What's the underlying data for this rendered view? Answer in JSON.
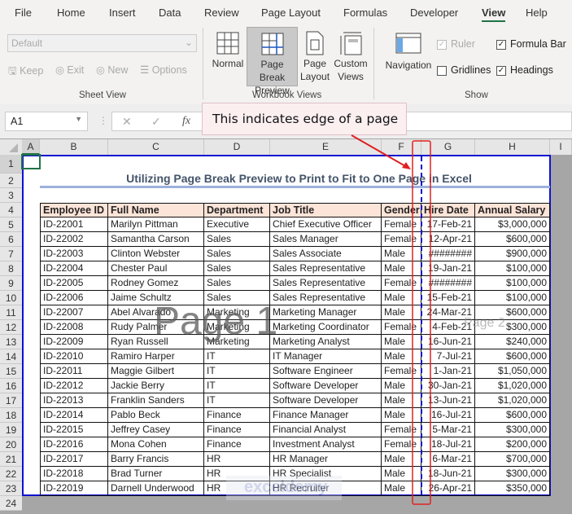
{
  "ribbon": {
    "tabs": [
      "File",
      "Home",
      "Insert",
      "Data",
      "Review",
      "Page Layout",
      "Formulas",
      "Developer",
      "View",
      "Help"
    ],
    "active_tab": "View",
    "sheet_view": {
      "dropdown": "Default",
      "keep": "Keep",
      "exit": "Exit",
      "new": "New",
      "options": "Options",
      "label": "Sheet View"
    },
    "workbook_views": {
      "normal": "Normal",
      "page_break_1": "Page Break",
      "page_break_2": "Preview",
      "page_layout_1": "Page",
      "page_layout_2": "Layout",
      "custom_1": "Custom",
      "custom_2": "Views",
      "label": "Workbook Views"
    },
    "show": {
      "navigation": "Navigation",
      "ruler": "Ruler",
      "ruler_checked": true,
      "formula_bar": "Formula Bar",
      "formula_bar_checked": true,
      "gridlines": "Gridlines",
      "gridlines_checked": false,
      "headings": "Headings",
      "headings_checked": true,
      "label": "Show"
    }
  },
  "formula_bar": {
    "name_box": "A1",
    "fx": "fx",
    "cancel": "✕",
    "enter": "✓",
    "formula": ""
  },
  "callout": "This indicates edge of a page",
  "columns": [
    "A",
    "B",
    "C",
    "D",
    "E",
    "F",
    "G",
    "H",
    "I"
  ],
  "rows": [
    "1",
    "2",
    "3",
    "4",
    "5",
    "6",
    "7",
    "8",
    "9",
    "10",
    "11",
    "12",
    "13",
    "14",
    "15",
    "16",
    "17",
    "18",
    "19",
    "20",
    "21",
    "22",
    "23",
    "24"
  ],
  "sheet": {
    "title": "Utilizing Page Break Preview to Print to Fit to One Page in Excel",
    "headers": [
      "Employee ID",
      "Full Name",
      "Department",
      "Job Title",
      "Gender",
      "Hire Date",
      "Annual Salary"
    ],
    "data": [
      [
        "ID-22001",
        "Marilyn Pittman",
        "Executive",
        "Chief Executive Officer",
        "Female",
        "17-Feb-21",
        "$3,000,000"
      ],
      [
        "ID-22002",
        "Samantha Carson",
        "Sales",
        "Sales Manager",
        "Female",
        "12-Apr-21",
        "$600,000"
      ],
      [
        "ID-22003",
        "Clinton Webster",
        "Sales",
        "Sales Associate",
        "Male",
        "########",
        "$900,000"
      ],
      [
        "ID-22004",
        "Chester Paul",
        "Sales",
        "Sales Representative",
        "Male",
        "19-Jan-21",
        "$100,000"
      ],
      [
        "ID-22005",
        "Rodney Gomez",
        "Sales",
        "Sales Representative",
        "Female",
        "########",
        "$100,000"
      ],
      [
        "ID-22006",
        "Jaime Schultz",
        "Sales",
        "Sales Representative",
        "Male",
        "15-Feb-21",
        "$100,000"
      ],
      [
        "ID-22007",
        "Abel Alvarado",
        "Marketing",
        "Marketing Manager",
        "Male",
        "24-Mar-21",
        "$600,000"
      ],
      [
        "ID-22008",
        "Rudy Palmer",
        "Marketing",
        "Marketing Coordinator",
        "Female",
        "4-Feb-21",
        "$300,000"
      ],
      [
        "ID-22009",
        "Ryan Russell",
        "Marketing",
        "Marketing Analyst",
        "Male",
        "16-Jun-21",
        "$240,000"
      ],
      [
        "ID-22010",
        "Ramiro Harper",
        "IT",
        "IT Manager",
        "Male",
        "7-Jul-21",
        "$600,000"
      ],
      [
        "ID-22011",
        "Maggie Gilbert",
        "IT",
        "Software Engineer",
        "Female",
        "1-Jan-21",
        "$1,050,000"
      ],
      [
        "ID-22012",
        "Jackie Berry",
        "IT",
        "Software Developer",
        "Male",
        "30-Jan-21",
        "$1,020,000"
      ],
      [
        "ID-22013",
        "Franklin Sanders",
        "IT",
        "Software Developer",
        "Male",
        "13-Jun-21",
        "$1,020,000"
      ],
      [
        "ID-22014",
        "Pablo Beck",
        "Finance",
        "Finance Manager",
        "Male",
        "16-Jul-21",
        "$600,000"
      ],
      [
        "ID-22015",
        "Jeffrey Casey",
        "Finance",
        "Financial Analyst",
        "Female",
        "5-Mar-21",
        "$300,000"
      ],
      [
        "ID-22016",
        "Mona Cohen",
        "Finance",
        "Investment Analyst",
        "Female",
        "18-Jul-21",
        "$200,000"
      ],
      [
        "ID-22017",
        "Barry Francis",
        "HR",
        "HR Manager",
        "Male",
        "6-Mar-21",
        "$700,000"
      ],
      [
        "ID-22018",
        "Brad Turner",
        "HR",
        "HR Specialist",
        "Male",
        "18-Jun-21",
        "$300,000"
      ],
      [
        "ID-22019",
        "Darnell Underwood",
        "HR",
        "HR Recruiter",
        "Male",
        "26-Apr-21",
        "$350,000"
      ]
    ],
    "page1_watermark": "Page 1",
    "page2_watermark": "Page 2",
    "logo": "exceldemy EXCEL · DATA · BI"
  },
  "colors": {
    "accent": "#217346",
    "page_border": "#1010d0",
    "header_fill": "#fde4d8",
    "callout_red": "#e02020"
  }
}
